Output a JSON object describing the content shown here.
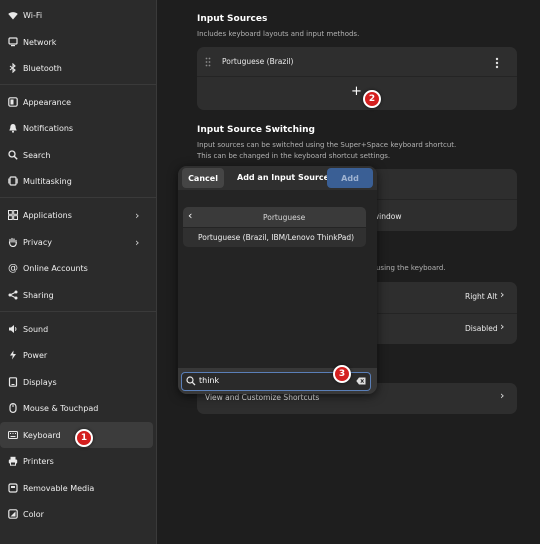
{
  "sidebar": {
    "items": [
      {
        "label": "Wi-Fi",
        "icon": "wifi-icon"
      },
      {
        "label": "Network",
        "icon": "network-icon"
      },
      {
        "label": "Bluetooth",
        "icon": "bluetooth-icon"
      },
      {
        "label": "Appearance",
        "icon": "appearance-icon"
      },
      {
        "label": "Notifications",
        "icon": "bell-icon"
      },
      {
        "label": "Search",
        "icon": "search-icon"
      },
      {
        "label": "Multitasking",
        "icon": "multitasking-icon"
      },
      {
        "label": "Applications",
        "icon": "grid-icon"
      },
      {
        "label": "Privacy",
        "icon": "hand-icon"
      },
      {
        "label": "Online Accounts",
        "icon": "at-icon"
      },
      {
        "label": "Sharing",
        "icon": "share-icon"
      },
      {
        "label": "Sound",
        "icon": "speaker-icon"
      },
      {
        "label": "Power",
        "icon": "power-icon"
      },
      {
        "label": "Displays",
        "icon": "display-icon"
      },
      {
        "label": "Mouse & Touchpad",
        "icon": "mouse-icon"
      },
      {
        "label": "Keyboard",
        "icon": "keyboard-icon"
      },
      {
        "label": "Printers",
        "icon": "printer-icon"
      },
      {
        "label": "Removable Media",
        "icon": "media-icon"
      },
      {
        "label": "Color",
        "icon": "color-icon"
      }
    ]
  },
  "main": {
    "input_sources": {
      "title": "Input Sources",
      "description": "Includes keyboard layouts and input methods.",
      "source_name": "Portuguese (Brazil)",
      "add_symbol": "+"
    },
    "switching": {
      "title": "Input Source Switching",
      "description_line1": "Input sources can be switched using the Super+Space keyboard shortcut.",
      "description_line2": "This can be changed in the keyboard shortcut settings.",
      "partial_window_text": "window",
      "partial_keyboard_text": "using the keyboard."
    },
    "special": {
      "alt_value": "Right Alt",
      "compose_value": "Disabled"
    },
    "shortcuts": {
      "label": "View and Customize Shortcuts"
    }
  },
  "dialog": {
    "cancel_label": "Cancel",
    "title": "Add an Input Source",
    "add_label": "Add",
    "category": "Portuguese",
    "result": "Portuguese (Brazil, IBM/Lenovo ThinkPad)",
    "search_value": "think"
  },
  "badges": {
    "one": "1",
    "two": "2",
    "three": "3"
  },
  "colors": {
    "accent": "#3a5f95",
    "badge": "#d41f1f"
  }
}
